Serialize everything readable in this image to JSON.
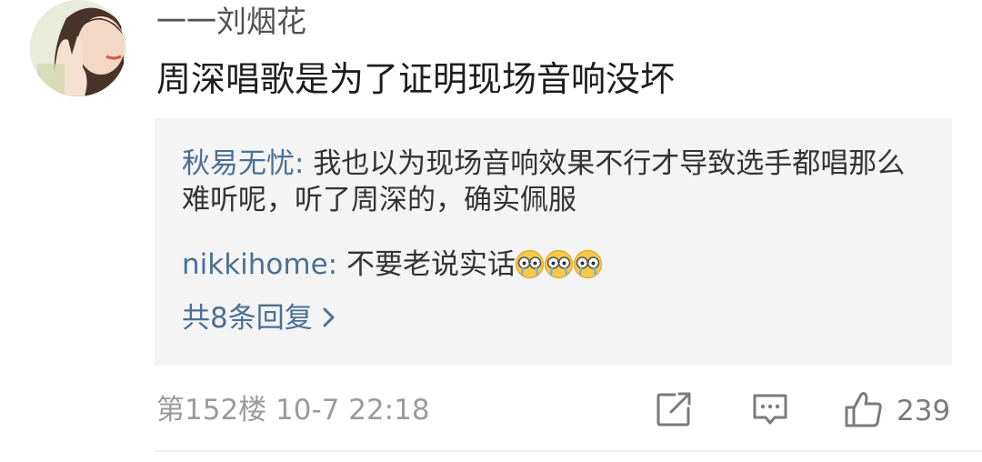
{
  "comment": {
    "username": "一一刘烟花",
    "text": "周深唱歌是为了证明现场音响没坏",
    "floor_time": "第152楼  10-7 22:18",
    "like_count": "239"
  },
  "replies": [
    {
      "user": "秋易无忧",
      "separator": ": ",
      "text": "我也以为现场音响效果不行才导致选手都唱那么难听呢，听了周深的，确实佩服"
    },
    {
      "user": "nikkihome",
      "separator": ": ",
      "text": "不要老说实话",
      "emojis": [
        "crying-glasses-emoji",
        "crying-glasses-emoji",
        "crying-glasses-emoji"
      ]
    }
  ],
  "more_replies": {
    "label": "共8条回复",
    "icon": "chevron-right-icon"
  },
  "actions": {
    "share_icon": "share-icon",
    "comment_icon": "comment-icon",
    "like_icon": "thumbs-up-icon"
  },
  "colors": {
    "link_blue": "#4a7094",
    "reply_bg": "#f4f4f4",
    "meta_gray": "#9b9b9b"
  }
}
